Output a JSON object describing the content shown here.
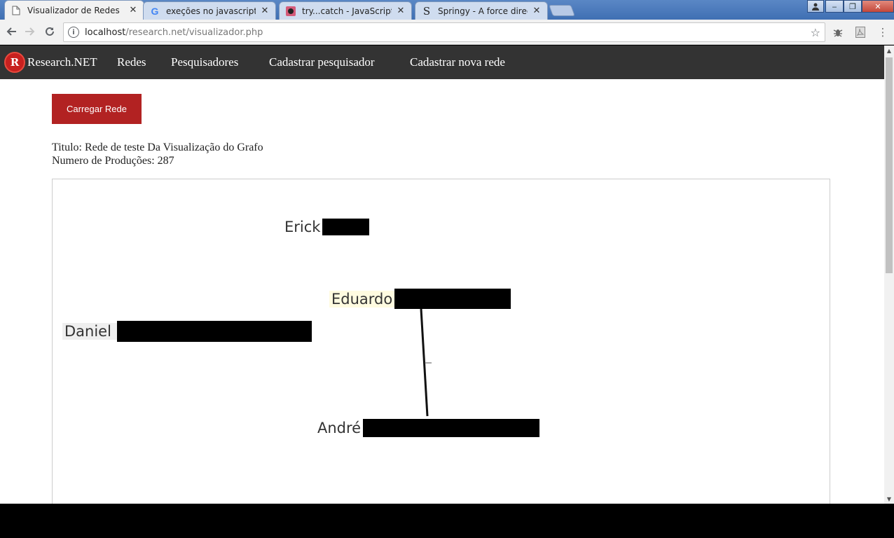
{
  "browser": {
    "tabs": [
      {
        "title": "Visualizador de Redes",
        "icon": "document-icon",
        "active": true
      },
      {
        "title": "exeções no javascript - P",
        "icon": "google-icon",
        "active": false
      },
      {
        "title": "try...catch - JavaScript | M",
        "icon": "mdn-icon",
        "active": false
      },
      {
        "title": "Springy - A force directe",
        "icon": "springy-icon",
        "active": false
      }
    ],
    "url_host": "localhost",
    "url_path": "/research.net/visualizador.php"
  },
  "navbar": {
    "brand": "Research.NET",
    "logo_letter": "R",
    "links": [
      "Redes",
      "Pesquisadores",
      "Cadastrar pesquisador",
      "Cadastrar nova rede"
    ]
  },
  "main": {
    "load_button": "Carregar Rede",
    "title_line": "Titulo: Rede de teste Da Visualização do Grafo",
    "productions_line": "Numero de Produções: 287"
  },
  "graph": {
    "nodes": [
      {
        "label": "Erick",
        "highlight": null
      },
      {
        "label": "Eduardo",
        "highlight": "#fffbe0"
      },
      {
        "label": "Daniel",
        "highlight": "#efefef"
      },
      {
        "label": "André",
        "highlight": null
      }
    ],
    "edges": [
      {
        "from": "Eduardo",
        "to": "André"
      }
    ]
  },
  "colors": {
    "navbar_bg": "#333333",
    "accent": "#b22222"
  }
}
